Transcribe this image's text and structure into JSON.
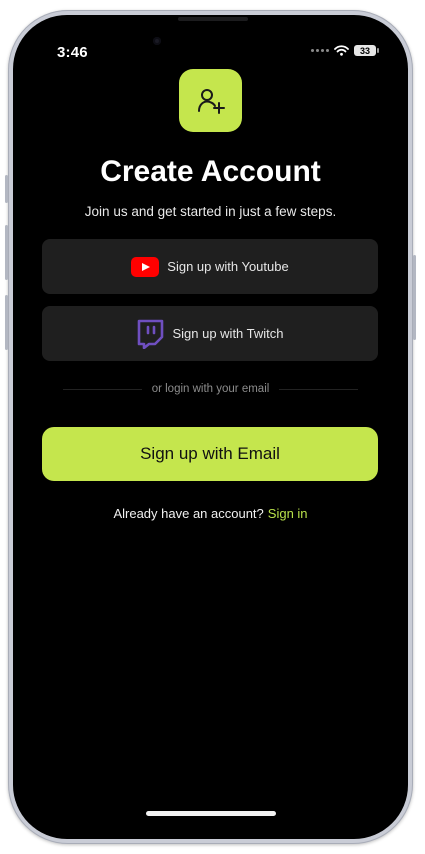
{
  "status_bar": {
    "time": "3:46",
    "battery": "33"
  },
  "header": {
    "icon": "add-user-icon",
    "title": "Create Account",
    "subtitle": "Join us and get started in just a few steps."
  },
  "social_buttons": [
    {
      "label": "Sign up with Youtube",
      "icon": "youtube-icon",
      "icon_color": "#ff0000"
    },
    {
      "label": "Sign up with Twitch",
      "icon": "twitch-icon",
      "icon_color": "#6f4fc0"
    }
  ],
  "divider_text": "or login with your email",
  "email_button": {
    "label": "Sign up with Email"
  },
  "signin": {
    "prompt": "Already have an account?",
    "link": "Sign in"
  },
  "colors": {
    "accent": "#c5e64d",
    "background": "#000000",
    "surface": "#1f1f1f",
    "link": "#b8e04a"
  }
}
